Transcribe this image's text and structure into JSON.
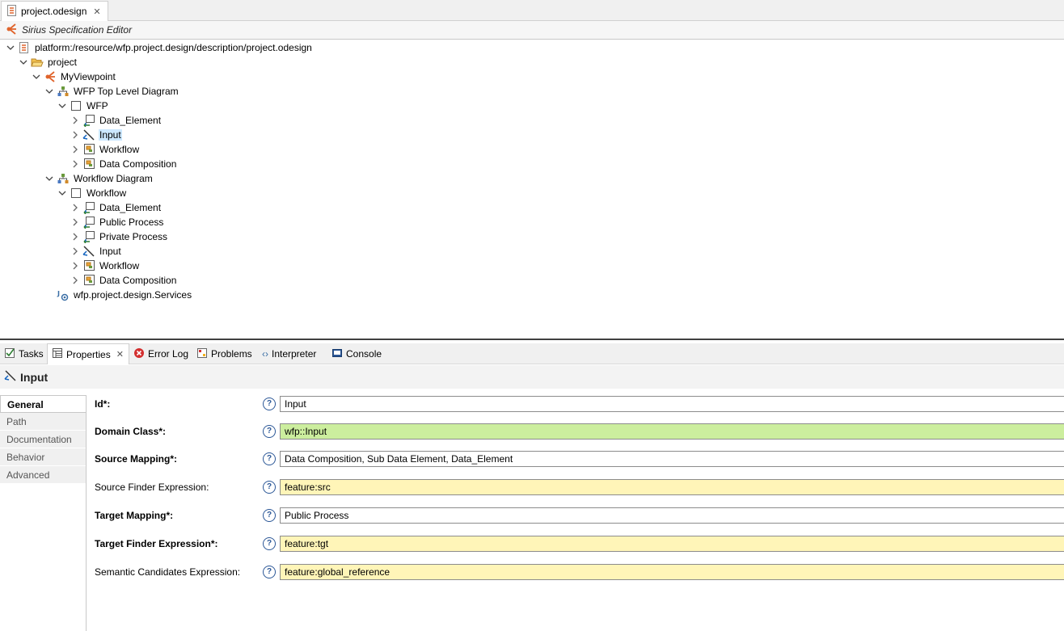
{
  "editor": {
    "tab_title": "project.odesign",
    "subtitle": "Sirius Specification Editor"
  },
  "tree": [
    {
      "label": "platform:/resource/wfp.project.design/description/project.odesign",
      "icon": "odesign-file-icon"
    },
    {
      "label": "project",
      "icon": "folder-open-icon"
    },
    {
      "label": "MyViewpoint",
      "icon": "viewpoint-icon"
    },
    {
      "label": "WFP Top Level Diagram",
      "icon": "diagram-icon"
    },
    {
      "label": "WFP",
      "icon": "layer-icon"
    },
    {
      "label": "Data_Element",
      "icon": "edge-mapping-icon"
    },
    {
      "label": "Input",
      "icon": "relation-edge-icon"
    },
    {
      "label": "Workflow",
      "icon": "container-mapping-icon"
    },
    {
      "label": "Data Composition",
      "icon": "container-mapping-icon"
    },
    {
      "label": "Workflow Diagram",
      "icon": "diagram-icon"
    },
    {
      "label": "Workflow",
      "icon": "layer-icon"
    },
    {
      "label": "Data_Element",
      "icon": "edge-mapping-icon"
    },
    {
      "label": "Public Process",
      "icon": "edge-mapping-icon"
    },
    {
      "label": "Private Process",
      "icon": "edge-mapping-icon"
    },
    {
      "label": "Input",
      "icon": "relation-edge-icon"
    },
    {
      "label": "Workflow",
      "icon": "container-mapping-icon"
    },
    {
      "label": "Data Composition",
      "icon": "container-mapping-icon"
    },
    {
      "label": "wfp.project.design.Services",
      "icon": "java-extension-icon"
    }
  ],
  "views": {
    "tabs": [
      {
        "label": "Tasks"
      },
      {
        "label": "Properties"
      },
      {
        "label": "Error Log"
      },
      {
        "label": "Problems"
      },
      {
        "label": "Interpreter"
      },
      {
        "label": "Console"
      }
    ],
    "active": "Properties"
  },
  "properties": {
    "title": "Input",
    "side_tabs": [
      "General",
      "Path",
      "Documentation",
      "Behavior",
      "Advanced"
    ],
    "active_side_tab": "General",
    "fields": [
      {
        "label": "Id*:",
        "value": "Input"
      },
      {
        "label": "Domain Class*:",
        "value": "wfp::Input"
      },
      {
        "label": "Source Mapping*:",
        "value": "Data Composition, Sub Data Element, Data_Element"
      },
      {
        "label": "Source Finder Expression:",
        "value": "feature:src"
      },
      {
        "label": "Target Mapping*:",
        "value": "Public Process"
      },
      {
        "label": "Target Finder Expression*:",
        "value": "feature:tgt"
      },
      {
        "label": "Semantic Candidates Expression:",
        "value": "feature:global_reference"
      }
    ],
    "help_glyph": "?"
  },
  "colors": {
    "selection": "#cce8ff",
    "domain_class_bg": "#ccee9e",
    "expression_bg": "#fff5b8",
    "sirius_orange": "#e0642c"
  }
}
